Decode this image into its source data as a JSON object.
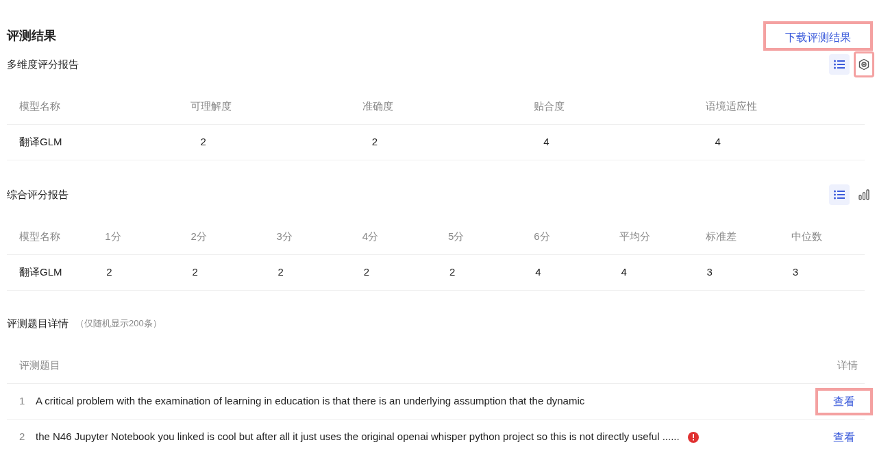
{
  "title": "评测结果",
  "download_link": {
    "label": "下载评测结果",
    "highlighted": true
  },
  "sections": [
    {
      "title": "多维度评分报告",
      "views": [
        {
          "kind": "list",
          "selected": true,
          "highlighted": false
        },
        {
          "kind": "settings",
          "selected": false,
          "highlighted": true
        }
      ],
      "table": {
        "columns": [
          "模型名称",
          "可理解度",
          "准确度",
          "贴合度",
          "语境适应性"
        ],
        "rows": [
          [
            "翻译GLM",
            "2",
            "2",
            "4",
            "4"
          ]
        ]
      }
    },
    {
      "title": "综合评分报告",
      "views": [
        {
          "kind": "list",
          "selected": true,
          "highlighted": false
        },
        {
          "kind": "chart",
          "selected": false,
          "highlighted": false
        }
      ],
      "table": {
        "columns": [
          "模型名称",
          "1分",
          "2分",
          "3分",
          "4分",
          "5分",
          "6分",
          "平均分",
          "标准差",
          "中位数"
        ],
        "rows": [
          [
            "翻译GLM",
            "2",
            "2",
            "2",
            "2",
            "2",
            "4",
            "4",
            "3",
            "3"
          ]
        ]
      }
    }
  ],
  "details": {
    "title": "评测题目详情",
    "note": "（仅随机显示200条）",
    "columns": [
      "评测题目",
      "详情"
    ],
    "rows": [
      {
        "index": "1",
        "question": "A critical problem with the examination of learning in education is that there is an underlying assumption that the dynamic",
        "warning": false,
        "action": "查看",
        "highlighted": true
      },
      {
        "index": "2",
        "question": "the N46 Jupyter Notebook you linked is cool but after all it just uses the original openai whisper python project so this is not directly useful ......",
        "warning": true,
        "action": "查看",
        "highlighted": false
      }
    ]
  }
}
